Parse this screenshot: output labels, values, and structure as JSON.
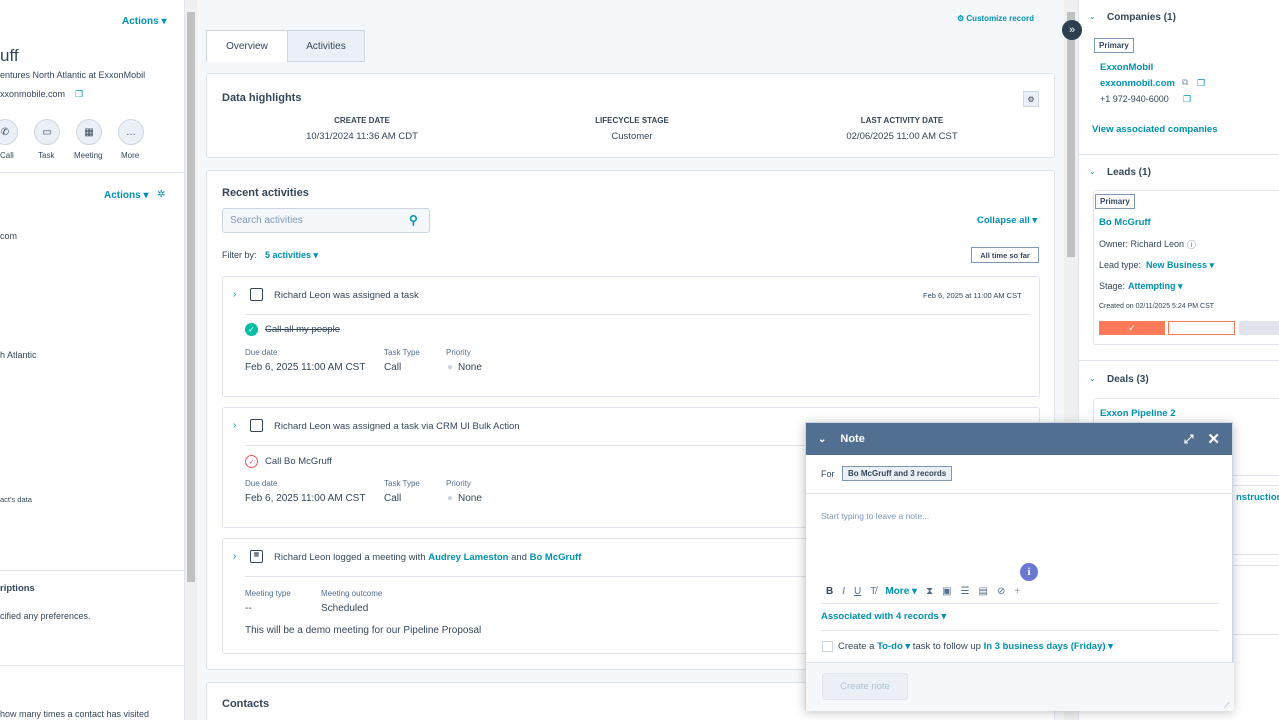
{
  "left": {
    "actions": "Actions ▾",
    "name_partial": "uff",
    "title_partial": "entures North Atlantic at ExxonMobil",
    "email_partial": "xxonmobile.com",
    "quick_actions": [
      "Call",
      "Task",
      "Meeting",
      "More"
    ],
    "about_actions": "Actions ▾",
    "field1_partial": "com",
    "field2_partial": "h Atlantic",
    "field3_partial": "act's data",
    "subs_title_partial": "riptions",
    "subs_text_partial": "cified any preferences.",
    "bottom_text_partial": "how many times a contact has visited"
  },
  "main": {
    "customize": "Customize record",
    "tabs": [
      "Overview",
      "Activities"
    ],
    "highlights": {
      "title": "Data highlights",
      "items": [
        {
          "label": "CREATE DATE",
          "value": "10/31/2024 11:36 AM CDT"
        },
        {
          "label": "LIFECYCLE STAGE",
          "value": "Customer"
        },
        {
          "label": "LAST ACTIVITY DATE",
          "value": "02/06/2025 11:00 AM CST"
        }
      ]
    },
    "recent": {
      "title": "Recent activities",
      "search_placeholder": "Search activities",
      "collapse": "Collapse all ▾",
      "filter_label": "Filter by:",
      "filter_value": "5 activities ▾",
      "time_range": "All time so far"
    },
    "activities": [
      {
        "title": "Richard Leon was assigned a task",
        "date": "Feb 6, 2025 at 11:00 AM CST",
        "task": "Call all my people",
        "due_label": "Due date",
        "due": "Feb 6, 2025  11:00 AM CST",
        "type_label": "Task Type",
        "type": "Call",
        "prio_label": "Priority",
        "prio": "None"
      },
      {
        "title": "Richard Leon was assigned a task via CRM UI Bulk Action",
        "task": "Call Bo McGruff",
        "due_label": "Due date",
        "due": "Feb 6, 2025  11:00 AM CST",
        "type_label": "Task Type",
        "type": "Call",
        "prio_label": "Priority",
        "prio": "None"
      },
      {
        "title_pre": "Richard Leon logged a meeting with ",
        "person1": "Audrey Lameston",
        "and": " and ",
        "person2": "Bo McGruff",
        "mt_label": "Meeting type",
        "mt": "--",
        "mo_label": "Meeting outcome",
        "mo": "Scheduled",
        "desc": "This will be a demo meeting for our Pipeline Proposal"
      }
    ],
    "contacts_title": "Contacts"
  },
  "right": {
    "companies": {
      "title": "Companies (1)",
      "tag": "Primary",
      "name": "ExxonMobil",
      "domain": "exxonmobil.com",
      "phone": "+1 972-940-6000",
      "view": "View associated companies"
    },
    "leads": {
      "title": "Leads (1)",
      "tag": "Primary",
      "name": "Bo McGruff",
      "owner": "Owner: Richard Leon",
      "type_label": "Lead type:",
      "type": "New Business ▾",
      "stage_label": "Stage:",
      "stage": "Attempting ▾",
      "created": "Created on 02/11/2025 5:24 PM CST"
    },
    "deals": {
      "title": "Deals (3)",
      "deal1": "Exxon Pipeline 2",
      "deal2_partial": "nstruction"
    }
  },
  "note": {
    "title": "Note",
    "for_label": "For",
    "for_value": "Bo McGruff and 3 records",
    "placeholder": "Start typing to leave a note...",
    "more": "More ▾",
    "associated": "Associated with 4 records ▾",
    "todo_pre": "Create a ",
    "todo_type": "To-do ▾",
    "todo_mid": " task to follow up ",
    "todo_when": "In 3 business days (Friday) ▾",
    "create": "Create note"
  },
  "colors": {
    "accent": "#0091ae",
    "header": "#516f90",
    "success": "#00bda5",
    "orange": "#ff7a59",
    "danger": "#f2545b"
  }
}
